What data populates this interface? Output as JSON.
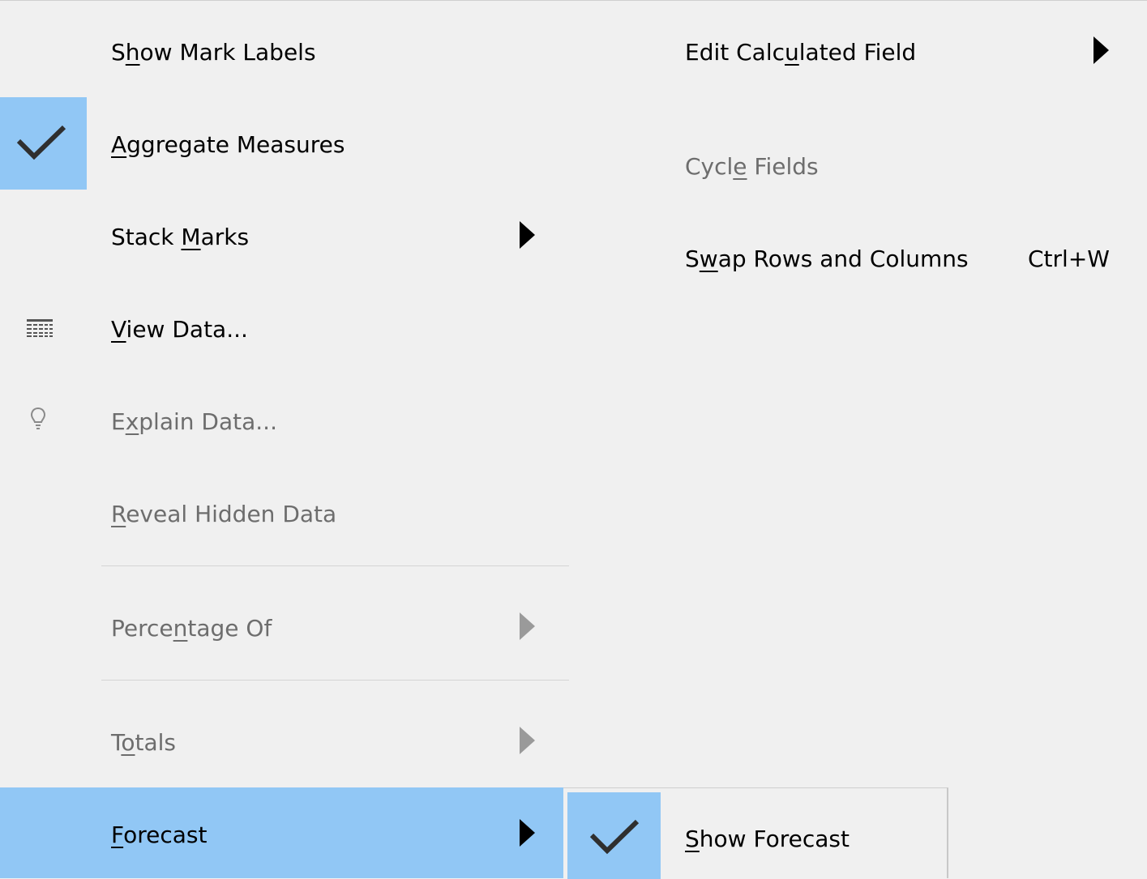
{
  "menu": {
    "items": [
      {
        "id": "show-mark-labels",
        "pre": "S",
        "mn": "h",
        "post": "ow Mark Labels",
        "enabled": true,
        "checked": false,
        "submenu": false
      },
      {
        "id": "aggregate-measures",
        "pre": "",
        "mn": "A",
        "post": "ggregate Measures",
        "enabled": true,
        "checked": true,
        "submenu": false
      },
      {
        "id": "stack-marks",
        "pre": "Stack ",
        "mn": "M",
        "post": "arks",
        "enabled": true,
        "checked": false,
        "submenu": true
      },
      {
        "id": "view-data",
        "pre": "",
        "mn": "V",
        "post": "iew Data...",
        "enabled": true,
        "checked": false,
        "submenu": false,
        "icon": "table-icon"
      },
      {
        "id": "explain-data",
        "pre": "E",
        "mn": "x",
        "post": "plain Data...",
        "enabled": false,
        "checked": false,
        "submenu": false,
        "icon": "lightbulb-icon"
      },
      {
        "id": "reveal-hidden-data",
        "pre": "",
        "mn": "R",
        "post": "eveal Hidden Data",
        "enabled": false,
        "checked": false,
        "submenu": false
      },
      {
        "id": "percentage-of",
        "pre": "Perce",
        "mn": "n",
        "post": "tage Of",
        "enabled": false,
        "checked": false,
        "submenu": true
      },
      {
        "id": "totals",
        "pre": "T",
        "mn": "o",
        "post": "tals",
        "enabled": false,
        "checked": false,
        "submenu": true
      },
      {
        "id": "forecast",
        "pre": "",
        "mn": "F",
        "post": "orecast",
        "enabled": true,
        "checked": false,
        "submenu": true,
        "highlighted": true
      }
    ],
    "right_items": [
      {
        "id": "edit-calculated-field",
        "pre": "Edit Calc",
        "mn": "u",
        "post": "lated Field",
        "enabled": true,
        "submenu": true
      },
      {
        "id": "cycle-fields",
        "pre": "Cycl",
        "mn": "e",
        "post": " Fields",
        "enabled": false,
        "submenu": false
      },
      {
        "id": "swap-rows-columns",
        "pre": "S",
        "mn": "w",
        "post": "ap Rows and Columns",
        "enabled": true,
        "submenu": false,
        "shortcut": "Ctrl+W"
      }
    ]
  },
  "submenu": {
    "items": [
      {
        "id": "show-forecast",
        "pre": "",
        "mn": "S",
        "post": "how Forecast",
        "checked": true
      }
    ]
  },
  "colors": {
    "highlight": "#91c7f5",
    "background": "#f0f0f0",
    "disabled_text": "#6d6d6d"
  },
  "icons": {
    "check": "checkmark-icon",
    "submenu_arrow": "submenu-arrow-icon"
  }
}
